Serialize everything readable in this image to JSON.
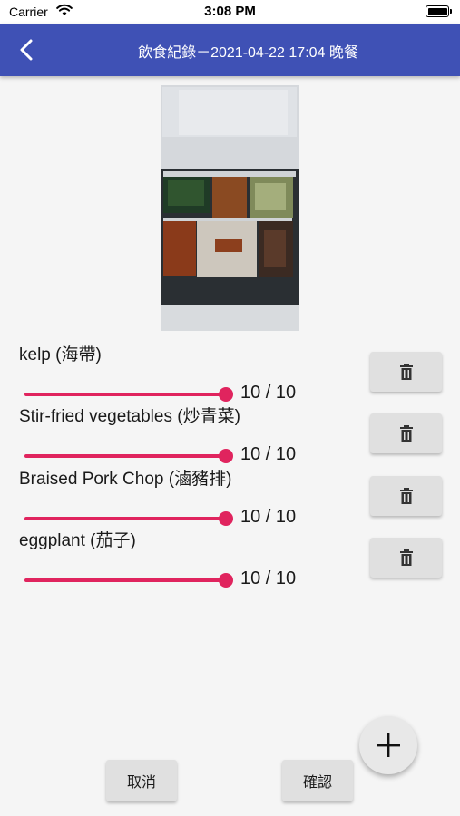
{
  "status_bar": {
    "carrier": "Carrier",
    "time": "3:08 PM"
  },
  "header": {
    "title": "飲食紀錄－2021-04-22 17:04 晚餐",
    "bar_color": "#3f51b5"
  },
  "food_items": [
    {
      "name": "kelp (海帶)",
      "score_text": "10 / 10",
      "score": 10,
      "max": 10,
      "delete_icon": "trash-icon"
    },
    {
      "name": "Stir-fried vegetables (炒青菜)",
      "score_text": "10 / 10",
      "score": 10,
      "max": 10,
      "delete_icon": "trash-icon"
    },
    {
      "name": "Braised Pork Chop (滷豬排)",
      "score_text": "10 / 10",
      "score": 10,
      "max": 10,
      "delete_icon": "trash-icon"
    },
    {
      "name": "eggplant (茄子)",
      "score_text": "10 / 10",
      "score": 10,
      "max": 10,
      "delete_icon": "trash-icon"
    }
  ],
  "slider_color": "#e0245e",
  "actions": {
    "cancel_label": "取消",
    "confirm_label": "確認",
    "add_icon": "plus-icon"
  }
}
